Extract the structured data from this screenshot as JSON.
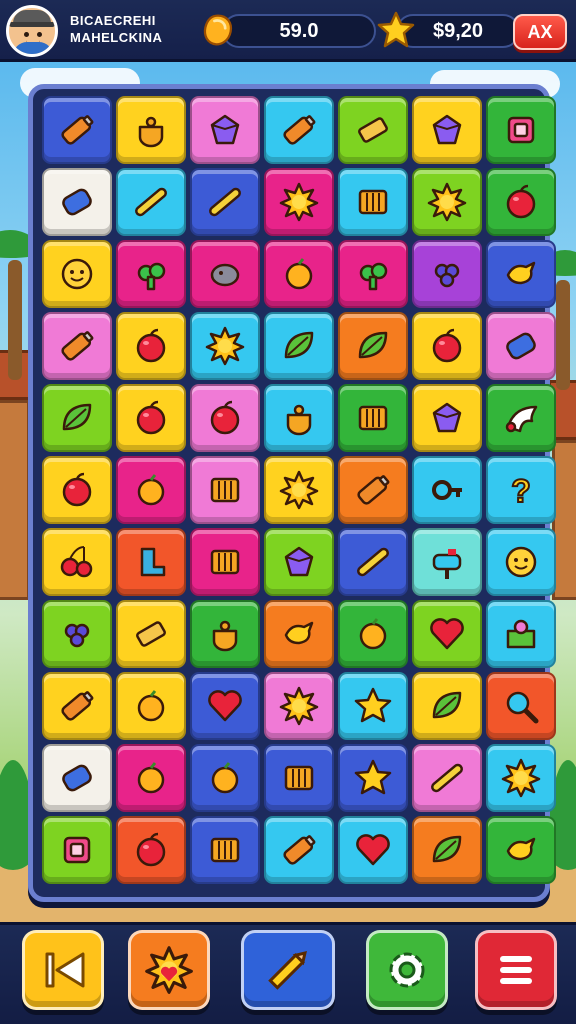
{
  "header": {
    "player_name_line1": "BICAECREHI",
    "player_name_line2": "MAHELCKINA",
    "coins_value": "59.0",
    "stars_value": "$9,20",
    "close_label": "AX",
    "coin_icon": "coin-icon",
    "star_icon": "star-icon"
  },
  "board": {
    "columns": 7,
    "rows": 11,
    "tiles": [
      [
        "#3d5bd6",
        "battery-icon"
      ],
      [
        "#ffd21f",
        "pot-icon"
      ],
      [
        "#f07ad6",
        "gem-icon"
      ],
      [
        "#35c8f0",
        "battery-icon"
      ],
      [
        "#7ed321",
        "bar-icon"
      ],
      [
        "#ffd21f",
        "gem-icon"
      ],
      [
        "#33b53a",
        "box-icon"
      ],
      [
        "#f4f1ea",
        "barrel-icon"
      ],
      [
        "#35c8f0",
        "stick-icon"
      ],
      [
        "#3d5bd6",
        "stick-icon"
      ],
      [
        "#e8238a",
        "sun-icon"
      ],
      [
        "#35c8f0",
        "crate-icon"
      ],
      [
        "#7ed321",
        "sun-icon"
      ],
      [
        "#33b53a",
        "apple-icon"
      ],
      [
        "#ffd21f",
        "face-icon"
      ],
      [
        "#e8238a",
        "plant-icon"
      ],
      [
        "#e8238a",
        "rock-icon"
      ],
      [
        "#e8238a",
        "fruit-icon"
      ],
      [
        "#e8238a",
        "plant-icon"
      ],
      [
        "#a742d8",
        "grapes-icon"
      ],
      [
        "#3d5bd6",
        "bird-icon"
      ],
      [
        "#f07ad6",
        "battery-icon"
      ],
      [
        "#ffd21f",
        "apple-icon"
      ],
      [
        "#35c8f0",
        "sun-icon"
      ],
      [
        "#35c8f0",
        "leaf-icon"
      ],
      [
        "#f57c1f",
        "leaf-icon"
      ],
      [
        "#ffd21f",
        "apple-icon"
      ],
      [
        "#f07ad6",
        "barrel-icon"
      ],
      [
        "#7ed321",
        "leaf-icon"
      ],
      [
        "#ffd21f",
        "apple-icon"
      ],
      [
        "#f07ad6",
        "apple-icon"
      ],
      [
        "#35c8f0",
        "pot-icon"
      ],
      [
        "#33b53a",
        "crate-icon"
      ],
      [
        "#ffd21f",
        "gem-icon"
      ],
      [
        "#33b53a",
        "wing-icon"
      ],
      [
        "#ffd21f",
        "apple-icon"
      ],
      [
        "#e8238a",
        "fruit-icon"
      ],
      [
        "#f07ad6",
        "crate-icon"
      ],
      [
        "#ffd21f",
        "sun-icon"
      ],
      [
        "#f57c1f",
        "battery-icon"
      ],
      [
        "#35c8f0",
        "key-icon"
      ],
      [
        "#35c8f0",
        "question-icon"
      ],
      [
        "#ffd21f",
        "cherry-icon"
      ],
      [
        "#f2562a",
        "boot-icon"
      ],
      [
        "#e8238a",
        "crate-icon"
      ],
      [
        "#7ed321",
        "gem-icon"
      ],
      [
        "#3d5bd6",
        "stick-icon"
      ],
      [
        "#6fe0d8",
        "mailbox-icon"
      ],
      [
        "#35c8f0",
        "face-icon"
      ],
      [
        "#7ed321",
        "grapes-icon"
      ],
      [
        "#ffd21f",
        "bar-icon"
      ],
      [
        "#33b53a",
        "pot-icon"
      ],
      [
        "#f57c1f",
        "bird-icon"
      ],
      [
        "#33b53a",
        "fruit-icon"
      ],
      [
        "#7ed321",
        "heart-icon"
      ],
      [
        "#35c8f0",
        "gift-icon"
      ],
      [
        "#ffd21f",
        "battery-icon"
      ],
      [
        "#ffd21f",
        "fruit-icon"
      ],
      [
        "#3d5bd6",
        "heart-icon"
      ],
      [
        "#f07ad6",
        "sun-icon"
      ],
      [
        "#35c8f0",
        "star-icon"
      ],
      [
        "#ffd21f",
        "leaf-icon"
      ],
      [
        "#f2562a",
        "magnifier-icon"
      ],
      [
        "#f4f1ea",
        "barrel-icon"
      ],
      [
        "#e8238a",
        "fruit-icon"
      ],
      [
        "#3d5bd6",
        "fruit-icon"
      ],
      [
        "#3d5bd6",
        "crate-icon"
      ],
      [
        "#3d5bd6",
        "star-icon"
      ],
      [
        "#f07ad6",
        "stick-icon"
      ],
      [
        "#35c8f0",
        "sun-icon"
      ],
      [
        "#7ed321",
        "box-icon"
      ],
      [
        "#f2562a",
        "apple-icon"
      ],
      [
        "#3d5bd6",
        "crate-icon"
      ],
      [
        "#35c8f0",
        "battery-icon"
      ],
      [
        "#35c8f0",
        "heart-icon"
      ],
      [
        "#f57c1f",
        "leaf-icon"
      ],
      [
        "#33b53a",
        "bird-icon"
      ]
    ]
  },
  "bottom": {
    "buttons": [
      {
        "name": "back-button",
        "icon": "back-icon",
        "color": "#ffc21a"
      },
      {
        "name": "booster-button",
        "icon": "sun-icon",
        "color": "#f57c1f"
      },
      {
        "name": "pencil-button",
        "icon": "pencil-icon",
        "color": "#2f62d9"
      },
      {
        "name": "settings-button",
        "icon": "gear-icon",
        "color": "#3fb83a"
      },
      {
        "name": "menu-button",
        "icon": "menu-icon",
        "color": "#e02836"
      }
    ]
  }
}
